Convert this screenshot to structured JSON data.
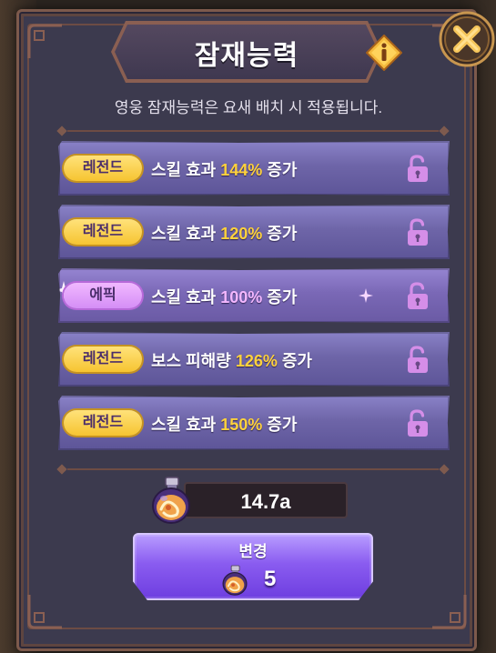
{
  "popup": {
    "title": "잠재능력",
    "subtitle": "영웅 잠재능력은 요새 배치 시 적용됩니다."
  },
  "potentials": [
    {
      "grade": "레전드",
      "grade_type": "legend",
      "prefix": "스킬 효과 ",
      "value": "144%",
      "suffix": " 증가",
      "locked": true
    },
    {
      "grade": "레전드",
      "grade_type": "legend",
      "prefix": "스킬 효과 ",
      "value": "120%",
      "suffix": " 증가",
      "locked": true
    },
    {
      "grade": "에픽",
      "grade_type": "epic",
      "prefix": "스킬 효과 ",
      "value": "100%",
      "suffix": " 증가",
      "locked": true
    },
    {
      "grade": "레전드",
      "grade_type": "legend",
      "prefix": "보스 피해량 ",
      "value": "126%",
      "suffix": " 증가",
      "locked": true
    },
    {
      "grade": "레전드",
      "grade_type": "legend",
      "prefix": "스킬 효과 ",
      "value": "150%",
      "suffix": " 증가",
      "locked": true
    }
  ],
  "currency": {
    "owned": "14.7a",
    "icon": "potion-icon"
  },
  "change_button": {
    "label": "변경",
    "cost": "5",
    "icon": "potion-icon"
  },
  "icons": {
    "info": "info-icon",
    "close": "close-icon",
    "lock": "unlocked-padlock-icon"
  },
  "colors": {
    "legend_badge": "#f6c431",
    "epic_badge": "#d58ef6",
    "value_highlight": "#ffd23c",
    "epic_value_highlight": "#f3b7ff",
    "row_fill": "#6e65a8",
    "lock": "#d58ee8",
    "button": "#8a5cf0"
  }
}
